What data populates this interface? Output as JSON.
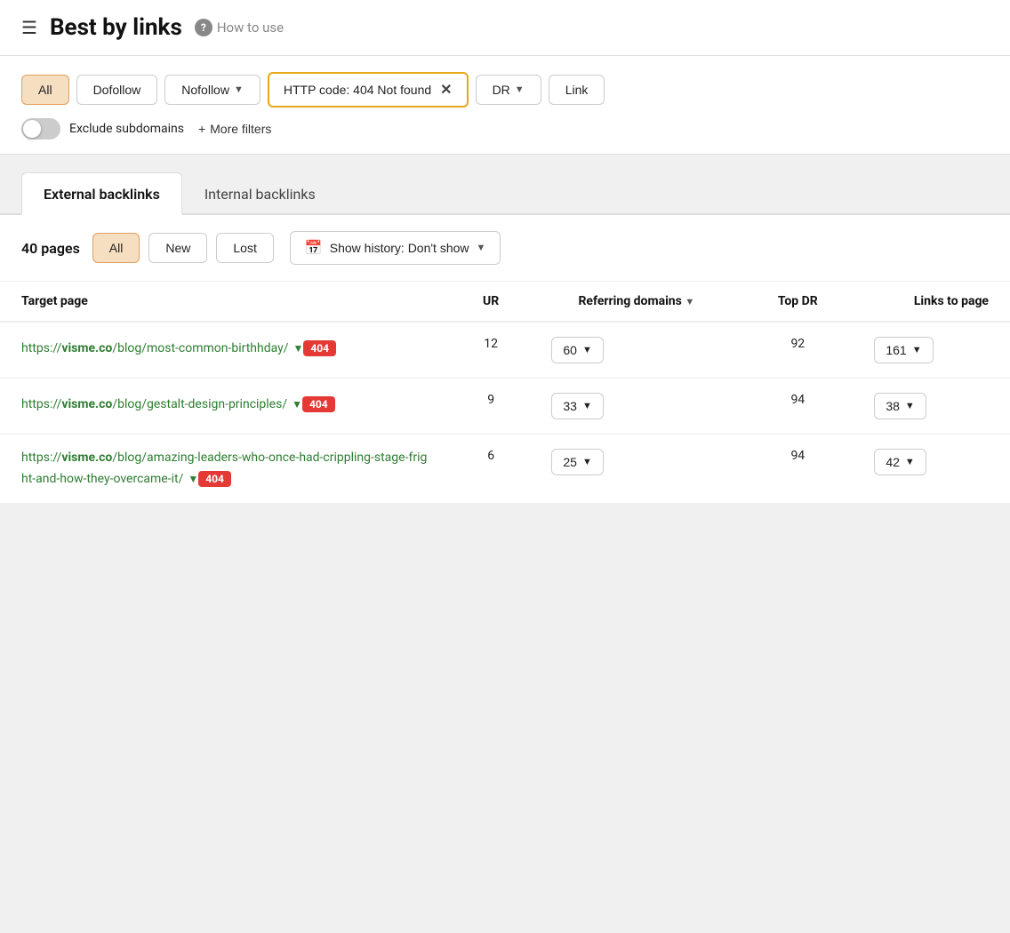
{
  "header": {
    "hamburger_label": "☰",
    "title": "Best by links",
    "help_icon": "?",
    "how_to_use_label": "How to use"
  },
  "filters": {
    "all_label": "All",
    "dofollow_label": "Dofollow",
    "nofollow_label": "Nofollow",
    "http_filter_label": "HTTP code: 404 Not found",
    "dr_label": "DR",
    "link_label": "Link",
    "exclude_subdomains_label": "Exclude subdomains",
    "more_filters_label": "More filters"
  },
  "tabs": [
    {
      "id": "external",
      "label": "External backlinks",
      "active": true
    },
    {
      "id": "internal",
      "label": "Internal backlinks",
      "active": false
    }
  ],
  "sub_filters": {
    "pages_count": "40 pages",
    "all_label": "All",
    "new_label": "New",
    "lost_label": "Lost",
    "show_history_label": "Show history: Don't show"
  },
  "table": {
    "columns": [
      {
        "id": "target_page",
        "label": "Target page"
      },
      {
        "id": "ur",
        "label": "UR"
      },
      {
        "id": "referring_domains",
        "label": "Referring domains",
        "sortable": true
      },
      {
        "id": "top_dr",
        "label": "Top DR"
      },
      {
        "id": "links_to_page",
        "label": "Links to page"
      }
    ],
    "rows": [
      {
        "url_prefix": "https://",
        "url_domain": "visme.co",
        "url_path": "/blog/most-common-birth\nhday/",
        "ur": "12",
        "referring_domains": "60",
        "top_dr": "92",
        "links_to_page": "161",
        "badge": "404"
      },
      {
        "url_prefix": "https://",
        "url_domain": "visme.co",
        "url_path": "/blog/gestalt-design-prin\nciples/",
        "ur": "9",
        "referring_domains": "33",
        "top_dr": "94",
        "links_to_page": "38",
        "badge": "404"
      },
      {
        "url_prefix": "https://",
        "url_domain": "visme.co",
        "url_path": "/blog/amazing-leaders-w\nho-once-had-crippling-stage-fright-and-h\now-they-overcame-it/",
        "ur": "6",
        "referring_domains": "25",
        "top_dr": "94",
        "links_to_page": "42",
        "badge": "404"
      }
    ]
  }
}
